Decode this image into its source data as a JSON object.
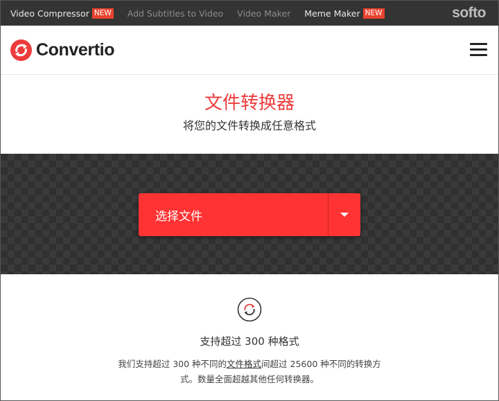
{
  "topbar": {
    "links": [
      {
        "label": "Video Compressor",
        "badge": "NEW"
      },
      {
        "label": "Add Subtitles to Video"
      },
      {
        "label": "Video Maker"
      },
      {
        "label": "Meme Maker",
        "badge": "NEW"
      }
    ],
    "brand": "softo"
  },
  "header": {
    "logo_text": "Convertio",
    "menu_icon": "hamburger-menu-icon"
  },
  "hero": {
    "title": "文件转换器",
    "subtitle": "将您的文件转换成任意格式"
  },
  "upload": {
    "choose_label": "选择文件",
    "dropdown_icon": "caret-down-icon"
  },
  "features": {
    "icon": "convert-cycle-icon",
    "title": "支持超过 300 种格式",
    "desc_part1": "我们支持超过 300 种不同的",
    "desc_link": "文件格式",
    "desc_part2": "间超过 25600 种不同的转换方式。数量全面超越其他任何转换器。"
  },
  "colors": {
    "accent": "#ff3333",
    "title_red": "#ee3b3b",
    "topbar_bg": "#343434",
    "badge": "#e9432f"
  }
}
